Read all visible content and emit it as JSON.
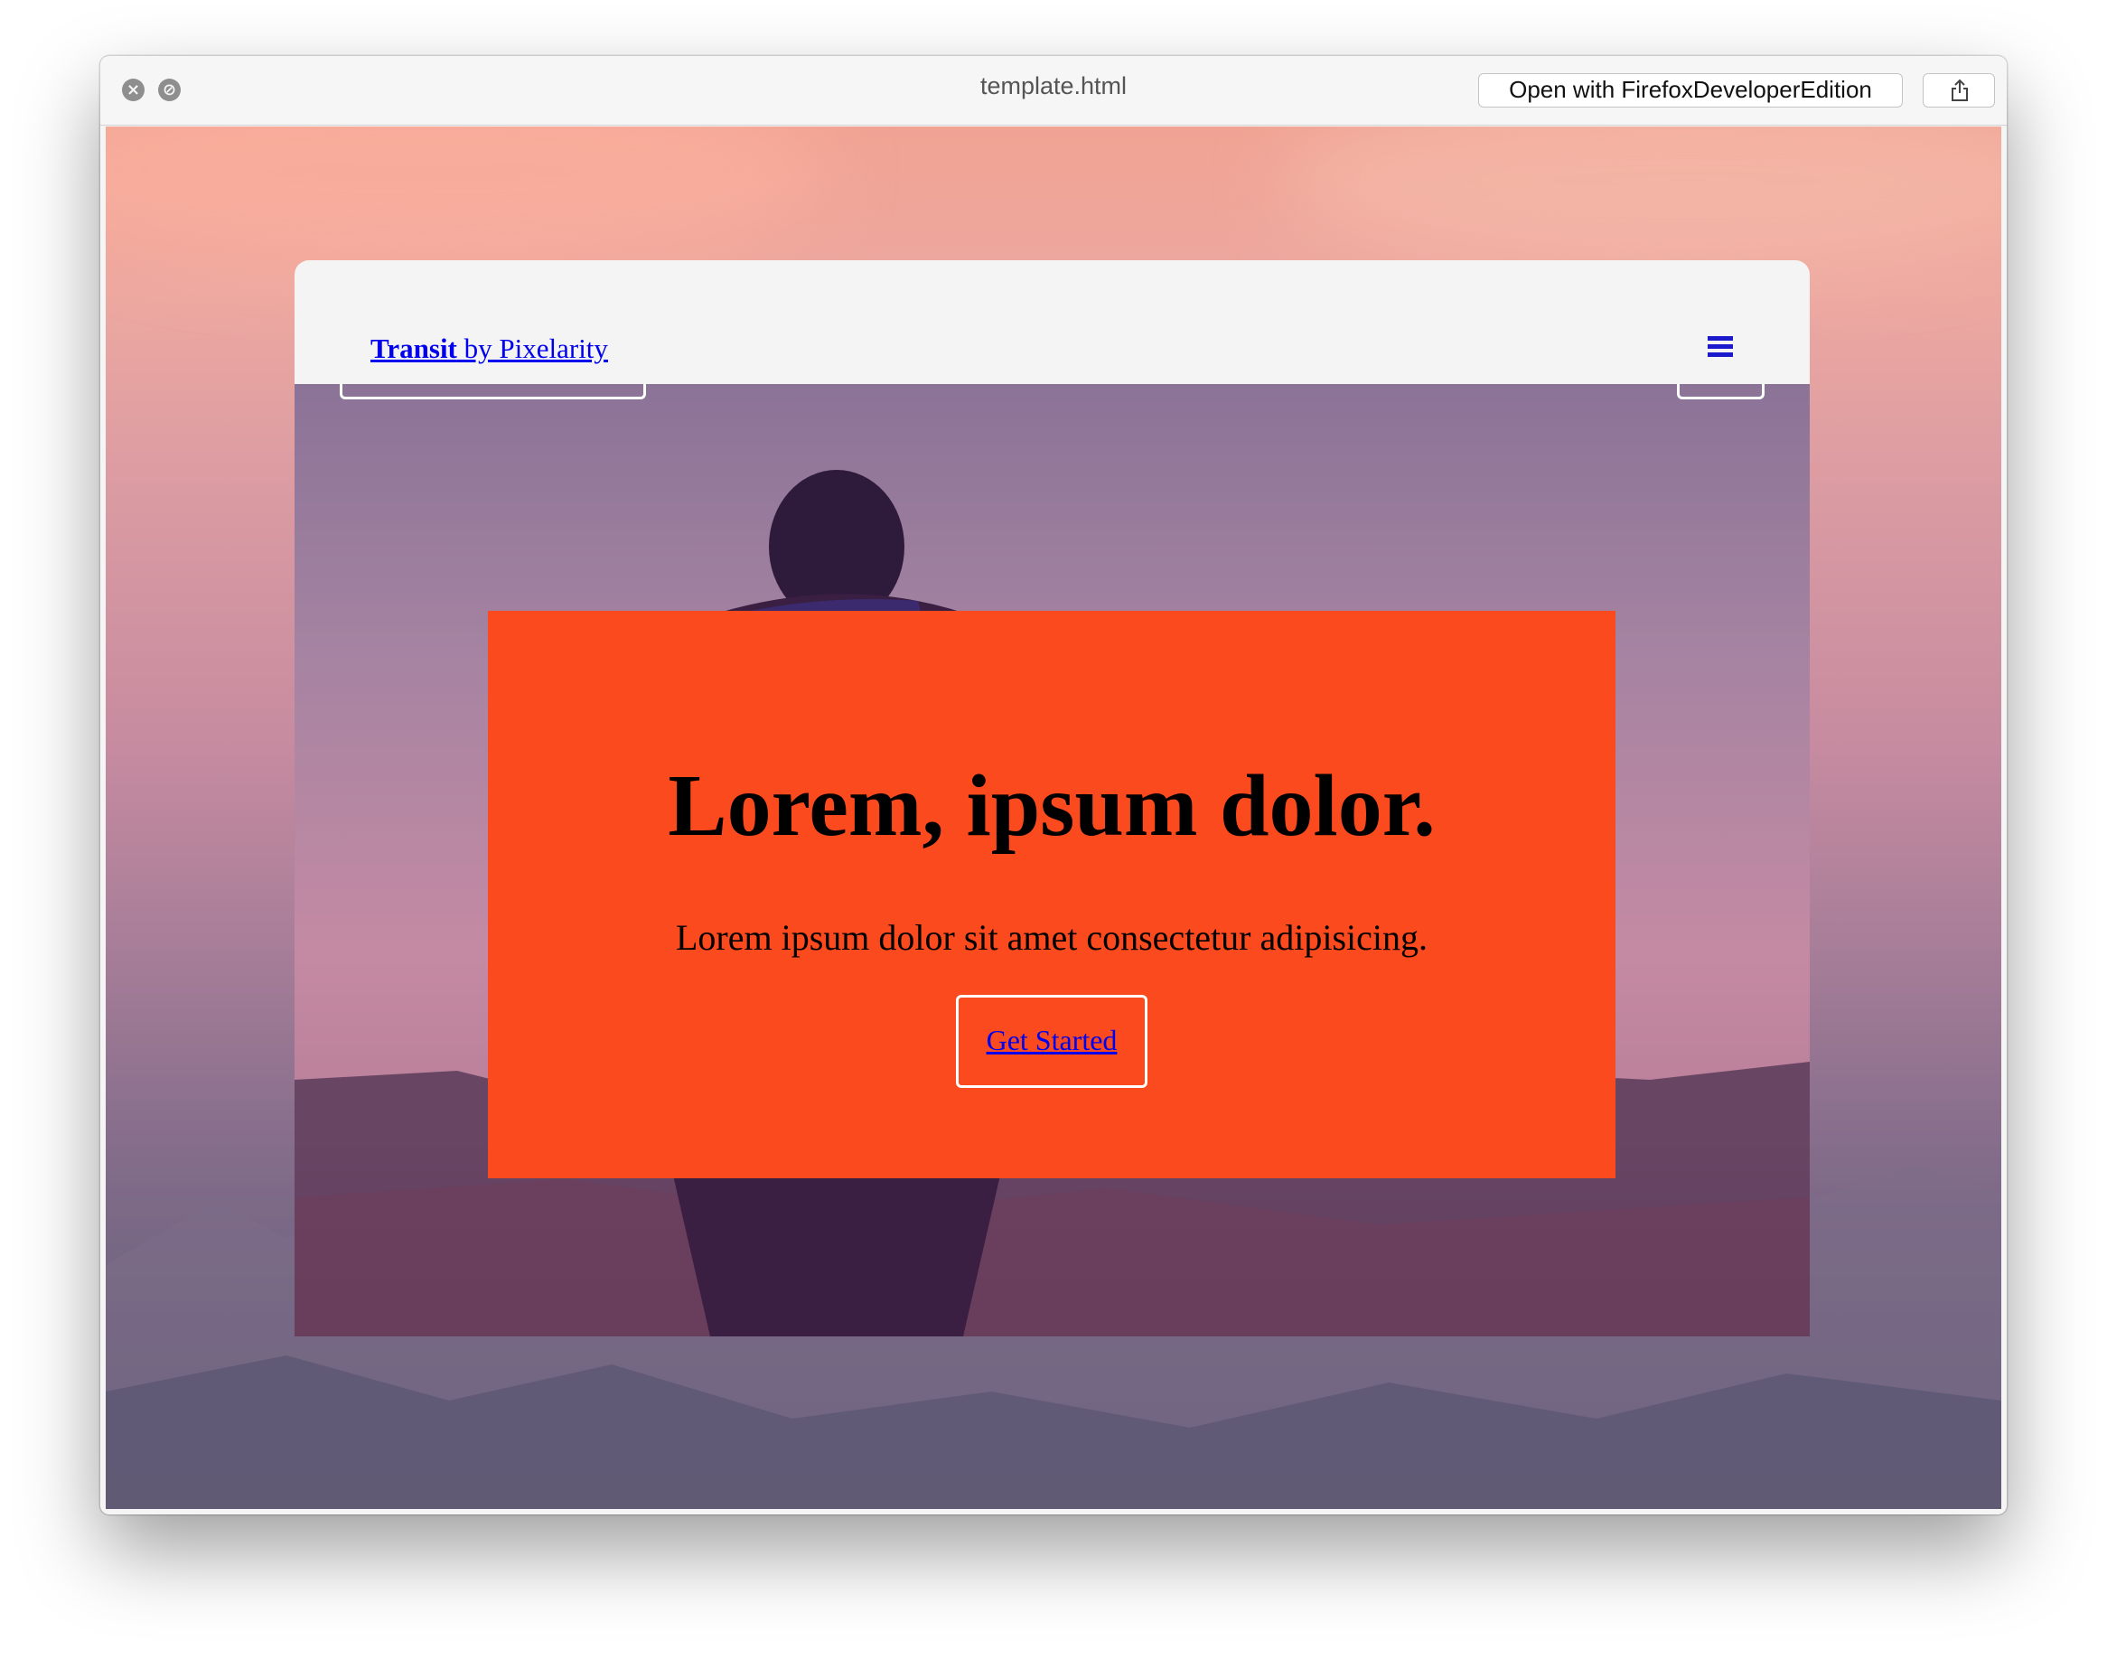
{
  "window": {
    "title": "template.html",
    "open_with_label": "Open with FirefoxDeveloperEdition",
    "close_glyph": "×",
    "disabled_glyph": "⊘"
  },
  "site": {
    "brand_bold": "Transit",
    "brand_rest": " by Pixelarity",
    "menu_icon": "hamburger-icon"
  },
  "hero": {
    "heading": "Lorem, ipsum dolor.",
    "subheading": "Lorem ipsum dolor sit amet consectetur adipisicing.",
    "cta_label": "Get Started",
    "card_color": "#fc4a1f"
  },
  "colors": {
    "link": "#0000ee",
    "menu": "#1a1acc"
  }
}
